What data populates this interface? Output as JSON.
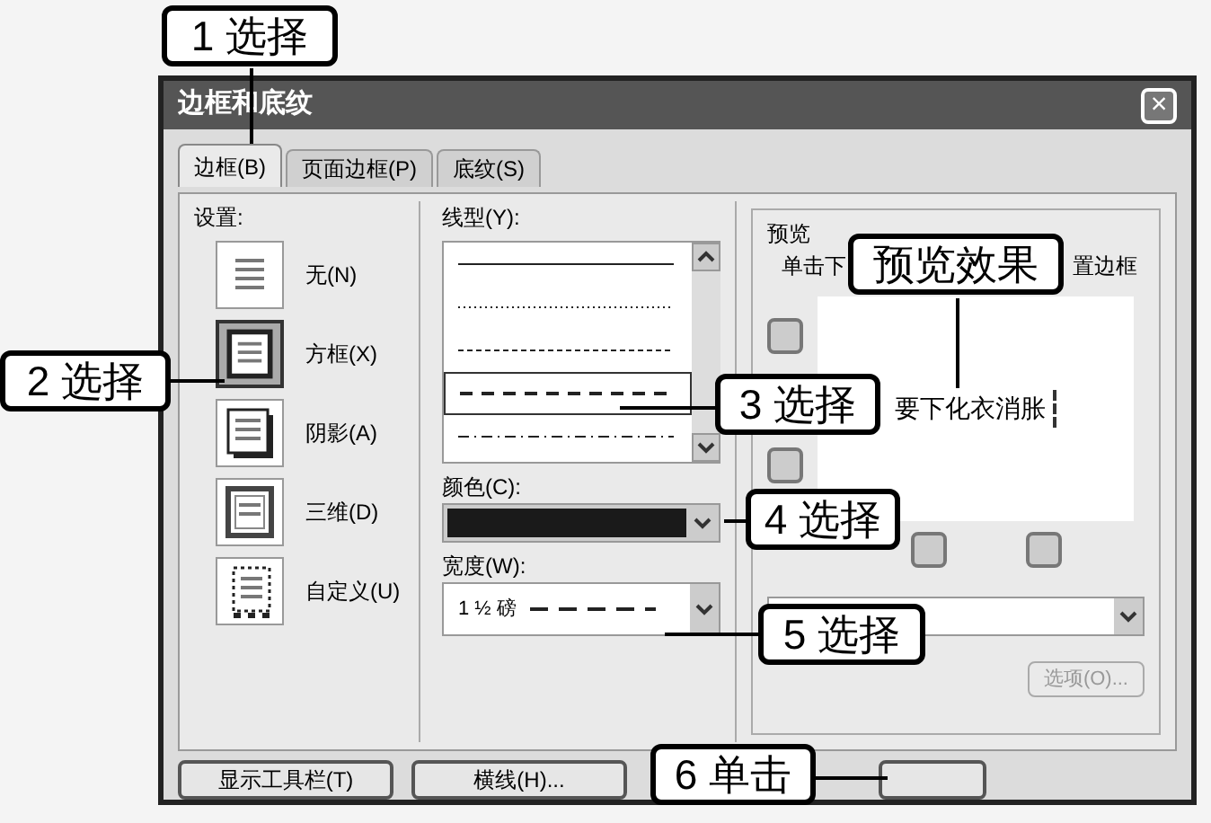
{
  "window": {
    "title": "边框和底纹",
    "close": "×"
  },
  "tabs": [
    {
      "label": "边框(B)",
      "selected": true
    },
    {
      "label": "页面边框(P)",
      "selected": false
    },
    {
      "label": "底纹(S)",
      "selected": false
    }
  ],
  "settings": {
    "label": "设置:",
    "items": [
      {
        "kind": "none",
        "label": "无(N)",
        "selected": false
      },
      {
        "kind": "box",
        "label": "方框(X)",
        "selected": true
      },
      {
        "kind": "shadow",
        "label": "阴影(A)",
        "selected": false
      },
      {
        "kind": "threed",
        "label": "三维(D)",
        "selected": false
      },
      {
        "kind": "custom",
        "label": "自定义(U)",
        "selected": false
      }
    ]
  },
  "line_style": {
    "label": "线型(Y):",
    "items": [
      {
        "kind": "solid",
        "selected": false
      },
      {
        "kind": "dotted",
        "selected": false
      },
      {
        "kind": "fine-dash",
        "selected": false
      },
      {
        "kind": "dash",
        "selected": true
      },
      {
        "kind": "dash-dot",
        "selected": false
      }
    ]
  },
  "color": {
    "label": "颜色(C):"
  },
  "width": {
    "label": "宽度(W):",
    "value": "1 ½ 磅"
  },
  "preview": {
    "label": "预览",
    "hint_start": "单击下",
    "hint_end": "置边框",
    "sample": "要下化衣消胀"
  },
  "options_button": {
    "label": "选项(O)...",
    "disabled": true
  },
  "buttons": [
    "显示工具栏(T)",
    "横线(H)..."
  ],
  "callouts": [
    {
      "text": "1 选择"
    },
    {
      "text": "2 选择"
    },
    {
      "text": "3 选择"
    },
    {
      "text": "预览效果"
    },
    {
      "text": "4 选择"
    },
    {
      "text": "5 选择"
    },
    {
      "text": "6 单击"
    }
  ]
}
